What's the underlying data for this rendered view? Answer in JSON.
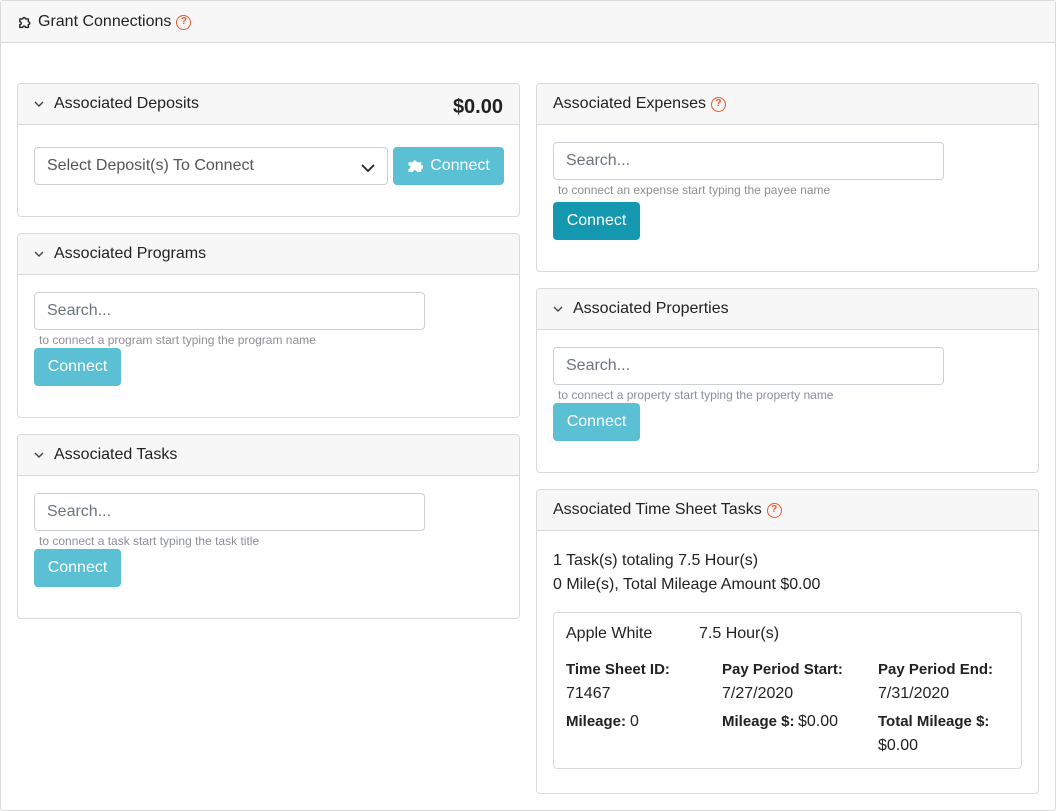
{
  "header": {
    "title": "Grant Connections",
    "help": "?"
  },
  "deposits": {
    "title": "Associated Deposits",
    "amount": "$0.00",
    "select_placeholder": "Select Deposit(s) To Connect",
    "connect_label": "Connect"
  },
  "programs": {
    "title": "Associated Programs",
    "search_placeholder": "Search...",
    "hint": "to connect a program start typing the program name",
    "connect_label": "Connect"
  },
  "tasks": {
    "title": "Associated Tasks",
    "search_placeholder": "Search...",
    "hint": "to connect a task start typing the task title",
    "connect_label": "Connect"
  },
  "expenses": {
    "title": "Associated Expenses",
    "help": "?",
    "search_placeholder": "Search...",
    "hint": "to connect an expense start typing the payee name",
    "connect_label": "Connect"
  },
  "properties": {
    "title": "Associated Properties",
    "search_placeholder": "Search...",
    "hint": "to connect a property start typing the property name",
    "connect_label": "Connect"
  },
  "timesheet": {
    "title": "Associated Time Sheet Tasks",
    "help": "?",
    "summary_line1": "1 Task(s) totaling 7.5 Hour(s)",
    "summary_line2": "0 Mile(s), Total Mileage Amount $0.00",
    "entry": {
      "name": "Apple White",
      "hours": "7.5 Hour(s)",
      "timesheet_id_label": "Time Sheet ID:",
      "timesheet_id": "71467",
      "pay_start_label": "Pay Period Start:",
      "pay_start": "7/27/2020",
      "pay_end_label": "Pay Period End:",
      "pay_end": "7/31/2020",
      "mileage_label": "Mileage:",
      "mileage": "0",
      "mileage_amount_label": "Mileage $:",
      "mileage_amount": "$0.00",
      "total_mileage_label": "Total Mileage $:",
      "total_mileage": "$0.00"
    }
  },
  "colors": {
    "accent_light": "#5bc0d3",
    "accent_dark": "#1498b0",
    "help": "#e8562a"
  }
}
